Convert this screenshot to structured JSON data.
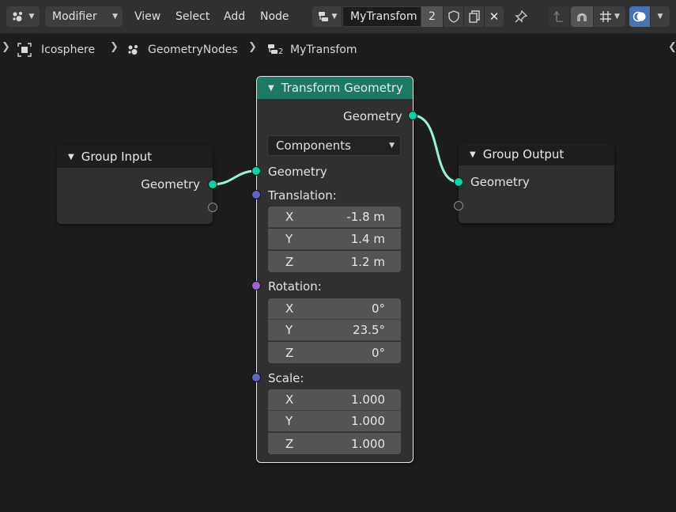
{
  "header": {
    "editor_type_icon": "geometry-nodes-icon",
    "mode_label": "Modifier",
    "menus": [
      "View",
      "Select",
      "Add",
      "Node"
    ],
    "tree_icon": "node-tree-icon",
    "node_tree_name": "MyTransfom",
    "user_count": "2",
    "fake_user_icon": "shield-icon",
    "duplicate_icon": "duplicate-icon",
    "unlink_icon": "close-icon",
    "pin_icon": "pin-icon",
    "parent_icon": "arrow-up-icon",
    "snap_icon": "magnet-icon",
    "snap_mode_icon": "grid-snap-icon",
    "overlay_icon": "overlay-icon"
  },
  "breadcrumb": {
    "items": [
      "Icosphere",
      "GeometryNodes",
      "MyTransfom"
    ],
    "tree_icon_subscript": "2"
  },
  "nodes": {
    "group_input": {
      "title": "Group Input",
      "outputs": [
        "Geometry"
      ]
    },
    "transform": {
      "title": "Transform Geometry",
      "output": "Geometry",
      "mode": "Components",
      "input_geometry": "Geometry",
      "translation": {
        "label": "Translation:",
        "x": "-1.8 m",
        "y": "1.4 m",
        "z": "1.2 m"
      },
      "rotation": {
        "label": "Rotation:",
        "x": "0°",
        "y": "23.5°",
        "z": "0°"
      },
      "scale": {
        "label": "Scale:",
        "x": "1.000",
        "y": "1.000",
        "z": "1.000"
      },
      "axes": [
        "X",
        "Y",
        "Z"
      ],
      "header_color": "#1c7a64"
    },
    "group_output": {
      "title": "Group Output",
      "inputs": [
        "Geometry"
      ]
    }
  },
  "colors": {
    "geometry_socket": "#00d6a3",
    "vector_socket": "#6363c7",
    "rotation_socket": "#a363d6",
    "link": "#9af2d6",
    "selected_outline": "#e6e6e6"
  }
}
